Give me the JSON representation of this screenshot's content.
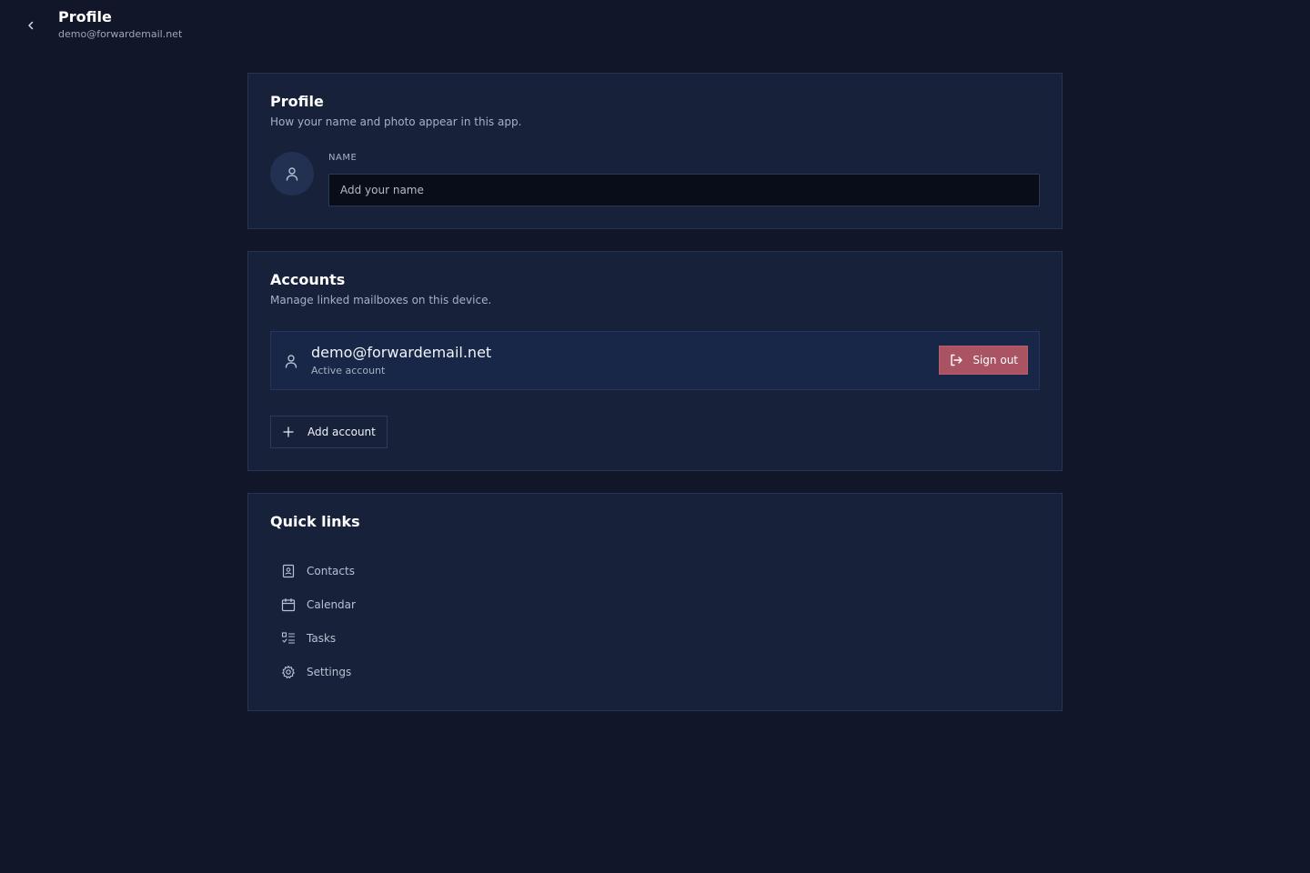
{
  "header": {
    "title": "Profile",
    "subtitle": "demo@forwardemail.net"
  },
  "profile": {
    "title": "Profile",
    "description": "How your name and photo appear in this app.",
    "name_label": "NAME",
    "name_placeholder": "Add your name",
    "name_value": ""
  },
  "accounts": {
    "title": "Accounts",
    "description": "Manage linked mailboxes on this device.",
    "items": [
      {
        "email": "demo@forwardemail.net",
        "status": "Active account",
        "action_label": "Sign out"
      }
    ],
    "add_label": "Add account"
  },
  "quick_links": {
    "title": "Quick links",
    "items": [
      {
        "label": "Contacts",
        "icon": "contacts-icon"
      },
      {
        "label": "Calendar",
        "icon": "calendar-icon"
      },
      {
        "label": "Tasks",
        "icon": "tasks-icon"
      },
      {
        "label": "Settings",
        "icon": "gear-icon"
      }
    ]
  },
  "colors": {
    "background": "#111729",
    "card": "#17213a",
    "danger": "#a95363"
  }
}
